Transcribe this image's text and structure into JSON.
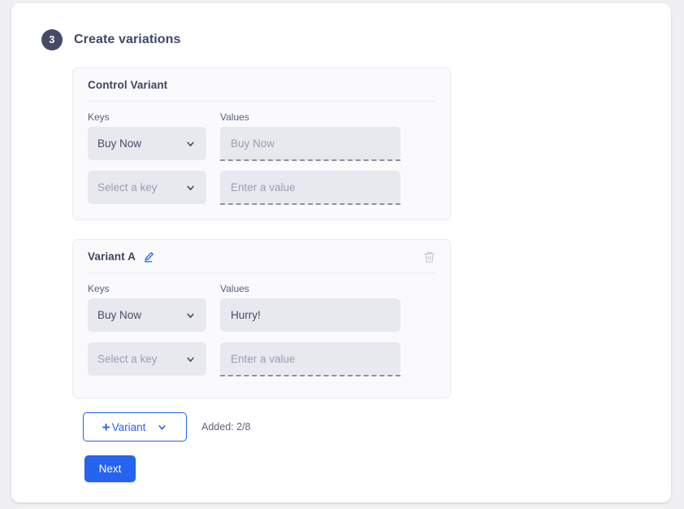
{
  "step": {
    "number": "3",
    "title": "Create variations"
  },
  "panels": [
    {
      "title": "Control Variant",
      "has_edit_icon": false,
      "has_delete_icon": false,
      "labels": {
        "keys": "Keys",
        "values": "Values"
      },
      "rows": [
        {
          "key_value": "Buy Now",
          "key_is_placeholder": false,
          "value_text": "Buy Now",
          "value_is_placeholder": true,
          "value_dashed": true
        },
        {
          "key_value": "Select a key",
          "key_is_placeholder": true,
          "value_text": "Enter a value",
          "value_is_placeholder": true,
          "value_dashed": true
        }
      ]
    },
    {
      "title": "Variant A",
      "has_edit_icon": true,
      "has_delete_icon": true,
      "labels": {
        "keys": "Keys",
        "values": "Values"
      },
      "rows": [
        {
          "key_value": "Buy Now",
          "key_is_placeholder": false,
          "value_text": "Hurry!",
          "value_is_placeholder": false,
          "value_dashed": false
        },
        {
          "key_value": "Select a key",
          "key_is_placeholder": true,
          "value_text": "Enter a value",
          "value_is_placeholder": true,
          "value_dashed": true
        }
      ]
    }
  ],
  "actions": {
    "add_variant_plus": "+",
    "add_variant_label": "Variant",
    "added_count": "Added: 2/8",
    "next_label": "Next"
  },
  "icons": {
    "edit": "pencil-icon",
    "delete": "trash-icon",
    "dropdown": "chevron-down-icon"
  },
  "colors": {
    "accent_blue": "#2563f0",
    "badge_navy": "#474a67",
    "field_grey": "#e8e9ef",
    "panel_bg": "#fafafc",
    "page_bg": "#f0f0f2"
  }
}
